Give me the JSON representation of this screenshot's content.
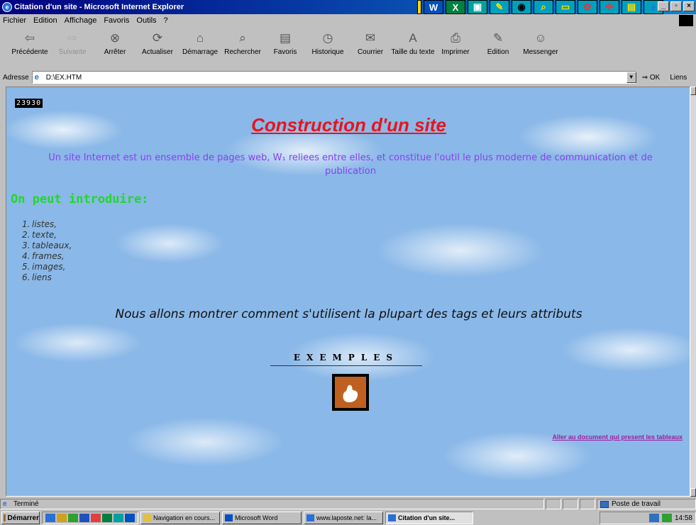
{
  "window": {
    "title": "Citation d'un site - Microsoft Internet Explorer"
  },
  "menu": [
    "Fichier",
    "Edition",
    "Affichage",
    "Favoris",
    "Outils",
    "?"
  ],
  "toolbar": [
    {
      "label": "Précédente",
      "icon": "back-arrow-icon",
      "glyph": "⇦",
      "disabled": false
    },
    {
      "label": "Suivante",
      "icon": "forward-arrow-icon",
      "glyph": "⇨",
      "disabled": true
    },
    {
      "label": "Arrêter",
      "icon": "stop-icon",
      "glyph": "⊗",
      "disabled": false
    },
    {
      "label": "Actualiser",
      "icon": "refresh-icon",
      "glyph": "⟳",
      "disabled": false
    },
    {
      "label": "Démarrage",
      "icon": "home-icon",
      "glyph": "⌂",
      "disabled": false
    },
    {
      "label": "Rechercher",
      "icon": "search-icon",
      "glyph": "⌕",
      "disabled": false
    },
    {
      "label": "Favoris",
      "icon": "favorites-icon",
      "glyph": "▤",
      "disabled": false
    },
    {
      "label": "Historique",
      "icon": "history-icon",
      "glyph": "◷",
      "disabled": false
    },
    {
      "label": "Courrier",
      "icon": "mail-icon",
      "glyph": "✉",
      "disabled": false
    },
    {
      "label": "Taille du texte",
      "icon": "text-size-icon",
      "glyph": "A",
      "disabled": false
    },
    {
      "label": "Imprimer",
      "icon": "print-icon",
      "glyph": "⎙",
      "disabled": false
    },
    {
      "label": "Edition",
      "icon": "edit-icon",
      "glyph": "✎",
      "disabled": false
    },
    {
      "label": "Messenger",
      "icon": "messenger-icon",
      "glyph": "☺",
      "disabled": false
    }
  ],
  "address": {
    "label": "Adresse",
    "value": "D:\\EX.HTM",
    "go_label": "OK",
    "links_label": "Liens"
  },
  "page": {
    "counter": "23930",
    "title": "Construction d'un site",
    "intro": "Un site Internet est un ensemble de pages web, W₁ reliees entre elles, et constitue l'outil le plus moderne de communication et de publication",
    "section_heading": "On peut introduire:",
    "items": [
      {
        "num": "1.",
        "text": "listes,"
      },
      {
        "num": "2.",
        "text": "texte,"
      },
      {
        "num": "3.",
        "text": "tableaux,"
      },
      {
        "num": "4.",
        "text": "frames,"
      },
      {
        "num": "5.",
        "text": "images,"
      },
      {
        "num": "6.",
        "text": "liens"
      }
    ],
    "subtitle": "Nous allons montrer comment s'utilisent la plupart des tags et leurs attributs",
    "examples_label": "EXEMPLES",
    "doc_link": "Aller au document qui present les tableaux"
  },
  "statusbar": {
    "status": "Terminé",
    "zone": "Poste de travail"
  },
  "taskbar": {
    "start_label": "Démarrer",
    "tasks": [
      {
        "label": "Navigation en cours...",
        "active": false
      },
      {
        "label": "Microsoft Word",
        "active": false
      },
      {
        "label": "www.laposte.net: la...",
        "active": false
      },
      {
        "label": "Citation d'un site...",
        "active": true
      }
    ],
    "clock": "14:58"
  },
  "colors": {
    "title_red": "#e8141c",
    "intro_violet": "#8a3ff0",
    "heading_green": "#22d82a",
    "link_purple": "#a020a0",
    "sky_blue": "#8ab8e8"
  }
}
